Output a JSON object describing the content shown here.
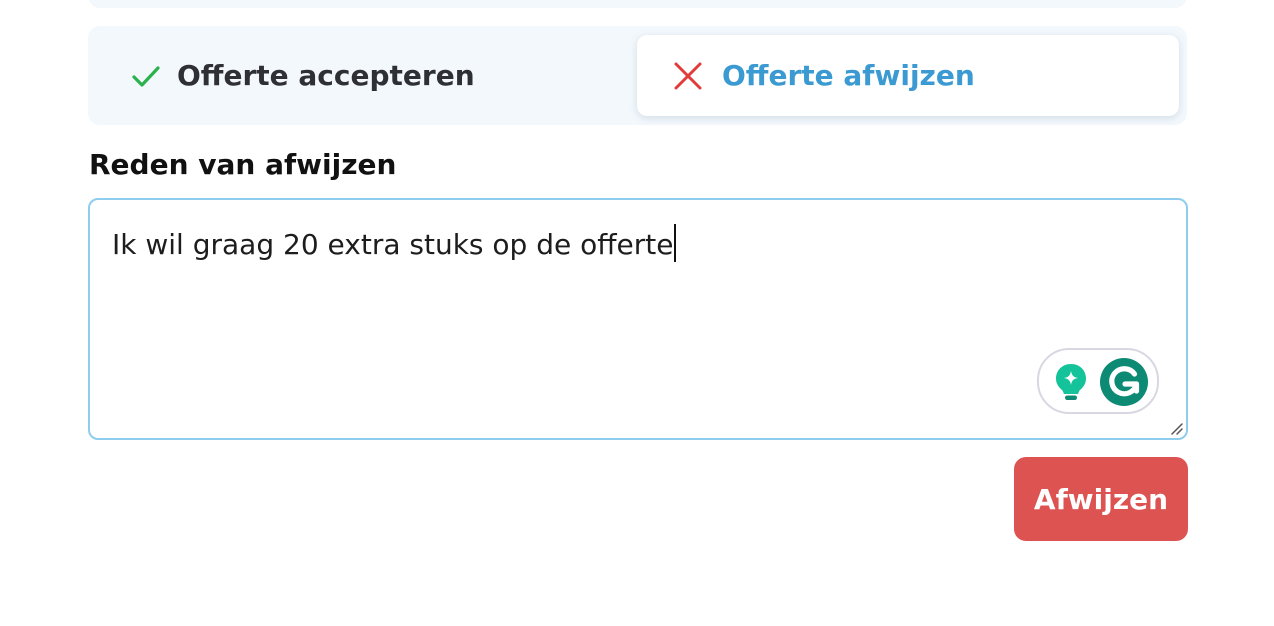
{
  "decision": {
    "accept_label": "Offerte accepteren",
    "reject_label": "Offerte afwijzen",
    "selected": "reject"
  },
  "reason": {
    "label": "Reden van afwijzen",
    "value": "Ik wil graag 20 extra stuks op de offerte"
  },
  "actions": {
    "reject_button": "Afwijzen"
  },
  "colors": {
    "accept_check": "#2bb24c",
    "reject_x": "#e23b3b",
    "selected_text": "#3a9ad1",
    "reject_button_bg": "#dd5352",
    "textarea_border": "#8ecdee",
    "grammarly_green": "#0d8a73"
  },
  "icons": {
    "accept": "check-icon",
    "reject": "x-icon",
    "grammarly_suggestion": "lightbulb-sparkle-icon",
    "grammarly_logo": "grammarly-g-icon",
    "resize": "resize-handle-icon"
  }
}
